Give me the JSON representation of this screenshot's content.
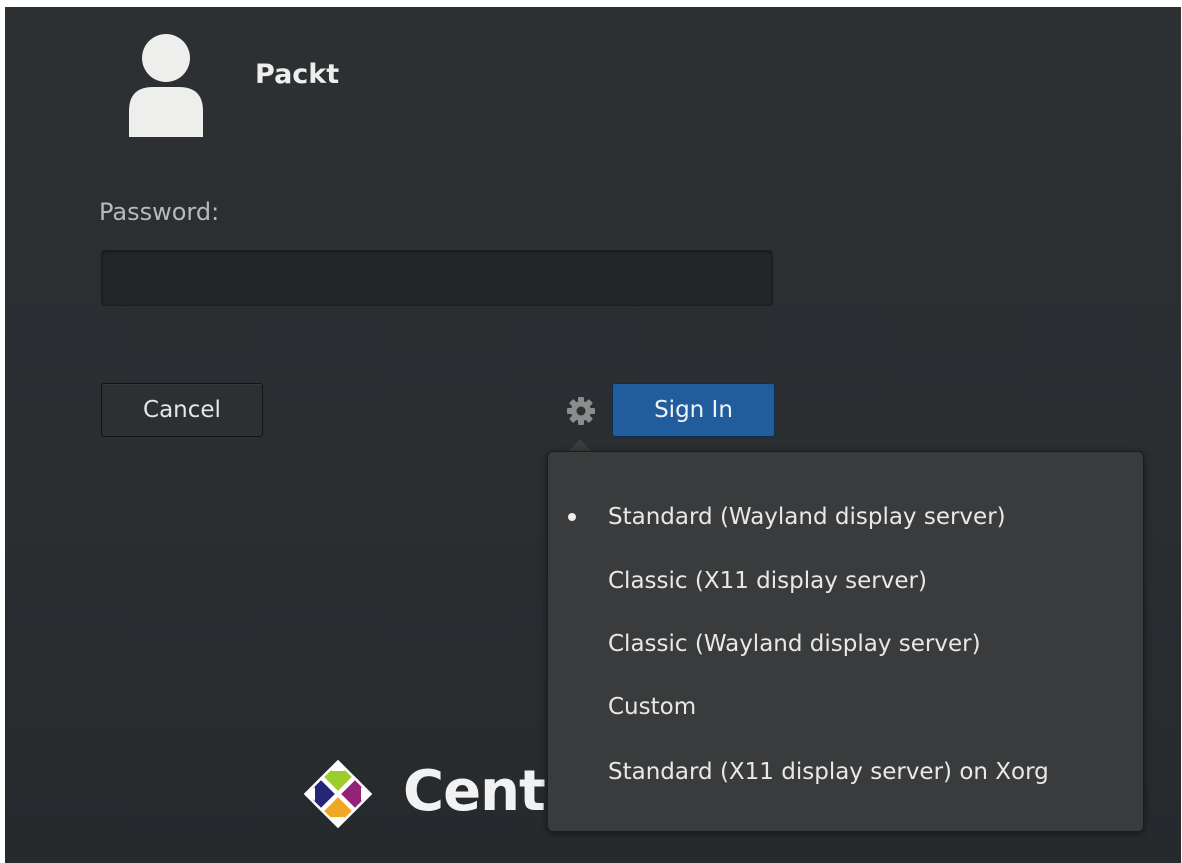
{
  "user": {
    "name": "Packt",
    "avatar_icon": "user-avatar-icon"
  },
  "password": {
    "label": "Password:",
    "value": "",
    "placeholder": ""
  },
  "buttons": {
    "cancel": "Cancel",
    "sign_in": "Sign In"
  },
  "session_menu": {
    "icon": "gear-icon",
    "items": [
      {
        "label": "Standard (Wayland display server)",
        "selected": true
      },
      {
        "label": "Classic (X11 display server)",
        "selected": false
      },
      {
        "label": "Classic (Wayland display server)",
        "selected": false
      },
      {
        "label": "Custom",
        "selected": false
      },
      {
        "label": "Standard (X11 display server) on Xorg",
        "selected": false
      }
    ]
  },
  "branding": {
    "logo_text": "Cent",
    "logo_icon": "centos-logo-icon"
  },
  "colors": {
    "background": "#2c3033",
    "sign_in_button": "#215d9c",
    "popover": "#3a3b3c",
    "text": "#eeeeec"
  }
}
